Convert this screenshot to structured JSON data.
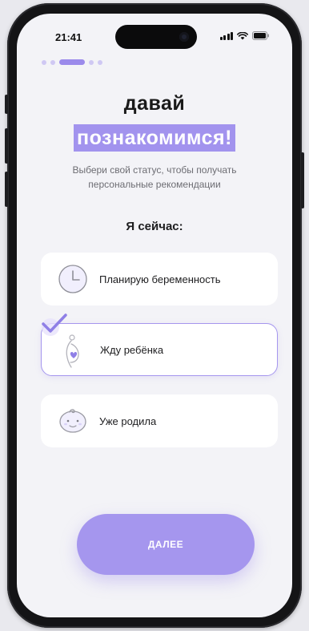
{
  "status_bar": {
    "time": "21:41"
  },
  "onboarding": {
    "progress": {
      "total_steps": 4,
      "current_step": 2
    }
  },
  "header": {
    "title_line1": "давай",
    "title_line2": "познакомимся!",
    "subtitle": "Выбери свой статус, чтобы получать персональные рекомендации"
  },
  "status_question": {
    "label": "Я сейчас:",
    "options": [
      {
        "label": "Планирую беременность",
        "icon": "clock-icon",
        "selected": false
      },
      {
        "label": "Жду ребёнка",
        "icon": "pregnant-icon",
        "selected": true
      },
      {
        "label": "Уже родила",
        "icon": "baby-face-icon",
        "selected": false
      }
    ]
  },
  "footer": {
    "next_label": "ДАЛЕЕ"
  },
  "colors": {
    "accent": "#a596ee",
    "accent_highlight": "#a293ee",
    "background": "#f3f3f7",
    "card": "#ffffff",
    "text_primary": "#1d1d1f",
    "text_secondary": "#6d6d73"
  }
}
